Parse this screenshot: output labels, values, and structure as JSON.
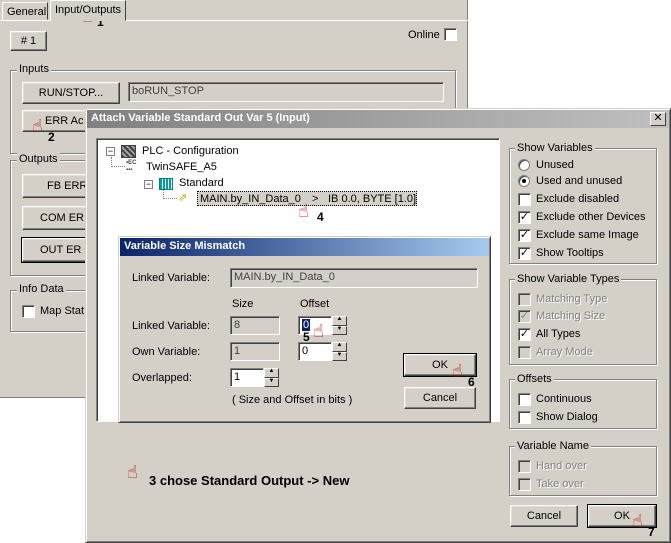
{
  "background_window": {
    "tabs": [
      {
        "label": "General"
      },
      {
        "label": "Input/Outputs"
      }
    ],
    "number_button": "# 1",
    "online_label": "Online",
    "inputs_group": {
      "title": "Inputs",
      "run_stop_button": "RUN/STOP...",
      "run_stop_value": "boRUN_STOP",
      "err_button": "ERR Ac"
    },
    "outputs_group": {
      "title": "Outputs",
      "fb_err_button": "FB ERR",
      "com_err_button": "COM ER",
      "out_err_button": "OUT ER"
    },
    "info_group": {
      "title": "Info Data",
      "map_label": "Map Stat"
    }
  },
  "attach_dialog": {
    "title": "Attach Variable Standard Out Var 5 (Input)",
    "close_glyph": "✕",
    "tree": {
      "root": "PLC - Configuration",
      "child": "TwinSAFE_A5",
      "grandchild": "Standard",
      "leaf_name": "MAIN.by_IN_Data_0",
      "leaf_arrow": ">",
      "leaf_info": "IB 0.0, BYTE [1.0]"
    },
    "show_variables": {
      "title": "Show Variables",
      "unused": "Unused",
      "used_and_unused": "Used and unused",
      "exclude_disabled": "Exclude disabled",
      "exclude_other_devices": "Exclude other Devices",
      "exclude_same_image": "Exclude same Image",
      "show_tooltips": "Show Tooltips"
    },
    "show_variable_types": {
      "title": "Show Variable Types",
      "matching_type": "Matching Type",
      "matching_size": "Matching Size",
      "all_types": "All Types",
      "array_mode": "Array Mode"
    },
    "offsets": {
      "title": "Offsets",
      "continuous": "Continuous",
      "show_dialog": "Show Dialog"
    },
    "variable_name": {
      "title": "Variable Name",
      "hand_over": "Hand over",
      "take_over": "Take over"
    },
    "cancel_button": "Cancel",
    "ok_button": "OK",
    "annotation_text": "3 chose Standard Output -> New"
  },
  "mismatch_dialog": {
    "title": "Variable Size Mismatch",
    "linked_variable_label": "Linked Variable:",
    "linked_variable_value": "MAIN.by_IN_Data_0",
    "size_header": "Size",
    "offset_header": "Offset",
    "row_linked_label": "Linked Variable:",
    "row_linked_size": "8",
    "row_linked_offset": "0",
    "row_own_label": "Own Variable:",
    "row_own_size": "1",
    "row_own_offset": "0",
    "overlapped_label": "Overlapped:",
    "overlapped_value": "1",
    "hint": "( Size and Offset in bits )",
    "ok_button": "OK",
    "cancel_button": "Cancel"
  },
  "step_markers": {
    "s1": "1",
    "s2": "2",
    "s4": "4",
    "s5": "5",
    "s6": "6",
    "s7": "7"
  },
  "colors": {
    "face": "#d4d0c8",
    "title_active_start": "#0a246a",
    "title_active_end": "#a6caf0",
    "title_inactive_start": "#808080",
    "title_inactive_end": "#c0c0c0",
    "pointer": "#c00000"
  }
}
